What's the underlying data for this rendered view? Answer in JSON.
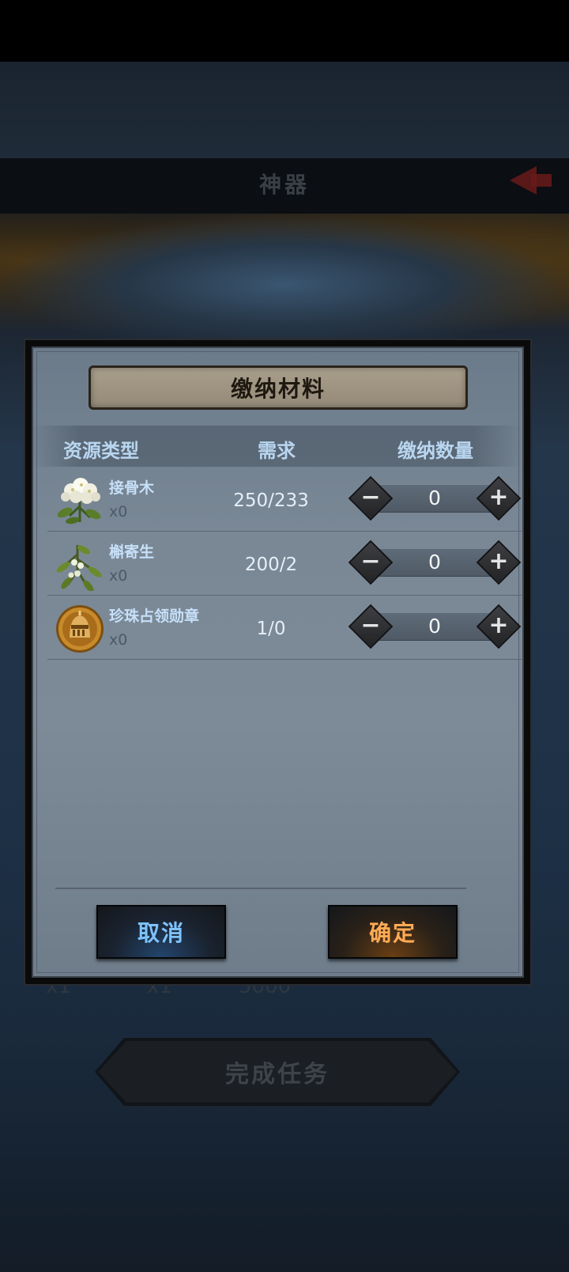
{
  "background": {
    "screen_title": "神器",
    "ghost_text": [
      "x1",
      "x1",
      "5000"
    ],
    "complete_task_label": "完成任务"
  },
  "dialog": {
    "title": "缴纳材料",
    "columns": {
      "resource_type": "资源类型",
      "requirement": "需求",
      "submit_quantity": "缴纳数量"
    },
    "items": [
      {
        "name": "接骨木",
        "owned": "x0",
        "requirement": "250/233",
        "quantity": "0",
        "icon": "elder-flower-icon"
      },
      {
        "name": "槲寄生",
        "owned": "x0",
        "requirement": "200/2",
        "quantity": "0",
        "icon": "mistletoe-icon"
      },
      {
        "name": "珍珠占领勋章",
        "owned": "x0",
        "requirement": "1/0",
        "quantity": "0",
        "icon": "pearl-occupation-medal-icon"
      }
    ],
    "minus_symbol": "−",
    "plus_symbol": "+",
    "cancel_label": "取消",
    "confirm_label": "确定"
  },
  "colors": {
    "cancel_text": "#7fc3ff",
    "confirm_text": "#ffaa55",
    "header_text": "#b9d6f0"
  }
}
